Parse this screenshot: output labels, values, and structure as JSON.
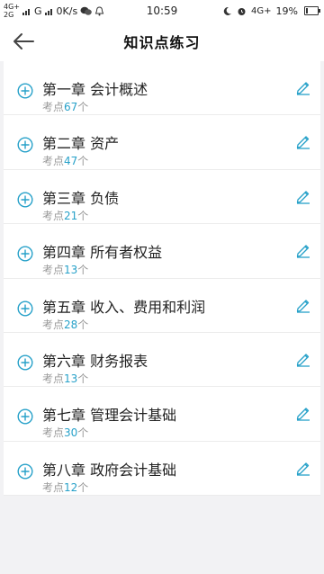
{
  "status_bar": {
    "net1_top": "4G+",
    "net1_bottom": "2G",
    "carrier_g": "G",
    "speed": "0K/s",
    "time": "10:59",
    "net2": "4G+",
    "battery": "19%",
    "battery_level": 0.19
  },
  "header": {
    "title": "知识点练习"
  },
  "colors": {
    "accent": "#27a1c9",
    "muted": "#999999"
  },
  "chapters": [
    {
      "title": "第一章 会计概述",
      "points_prefix": "考点",
      "count": "67",
      "points_suffix": "个"
    },
    {
      "title": "第二章 资产",
      "points_prefix": "考点",
      "count": "47",
      "points_suffix": "个"
    },
    {
      "title": "第三章 负债",
      "points_prefix": "考点",
      "count": "21",
      "points_suffix": "个"
    },
    {
      "title": "第四章 所有者权益",
      "points_prefix": "考点",
      "count": "13",
      "points_suffix": "个"
    },
    {
      "title": "第五章 收入、费用和利润",
      "points_prefix": "考点",
      "count": "28",
      "points_suffix": "个"
    },
    {
      "title": "第六章 财务报表",
      "points_prefix": "考点",
      "count": "13",
      "points_suffix": "个"
    },
    {
      "title": "第七章 管理会计基础",
      "points_prefix": "考点",
      "count": "30",
      "points_suffix": "个"
    },
    {
      "title": "第八章 政府会计基础",
      "points_prefix": "考点",
      "count": "12",
      "points_suffix": "个"
    }
  ]
}
